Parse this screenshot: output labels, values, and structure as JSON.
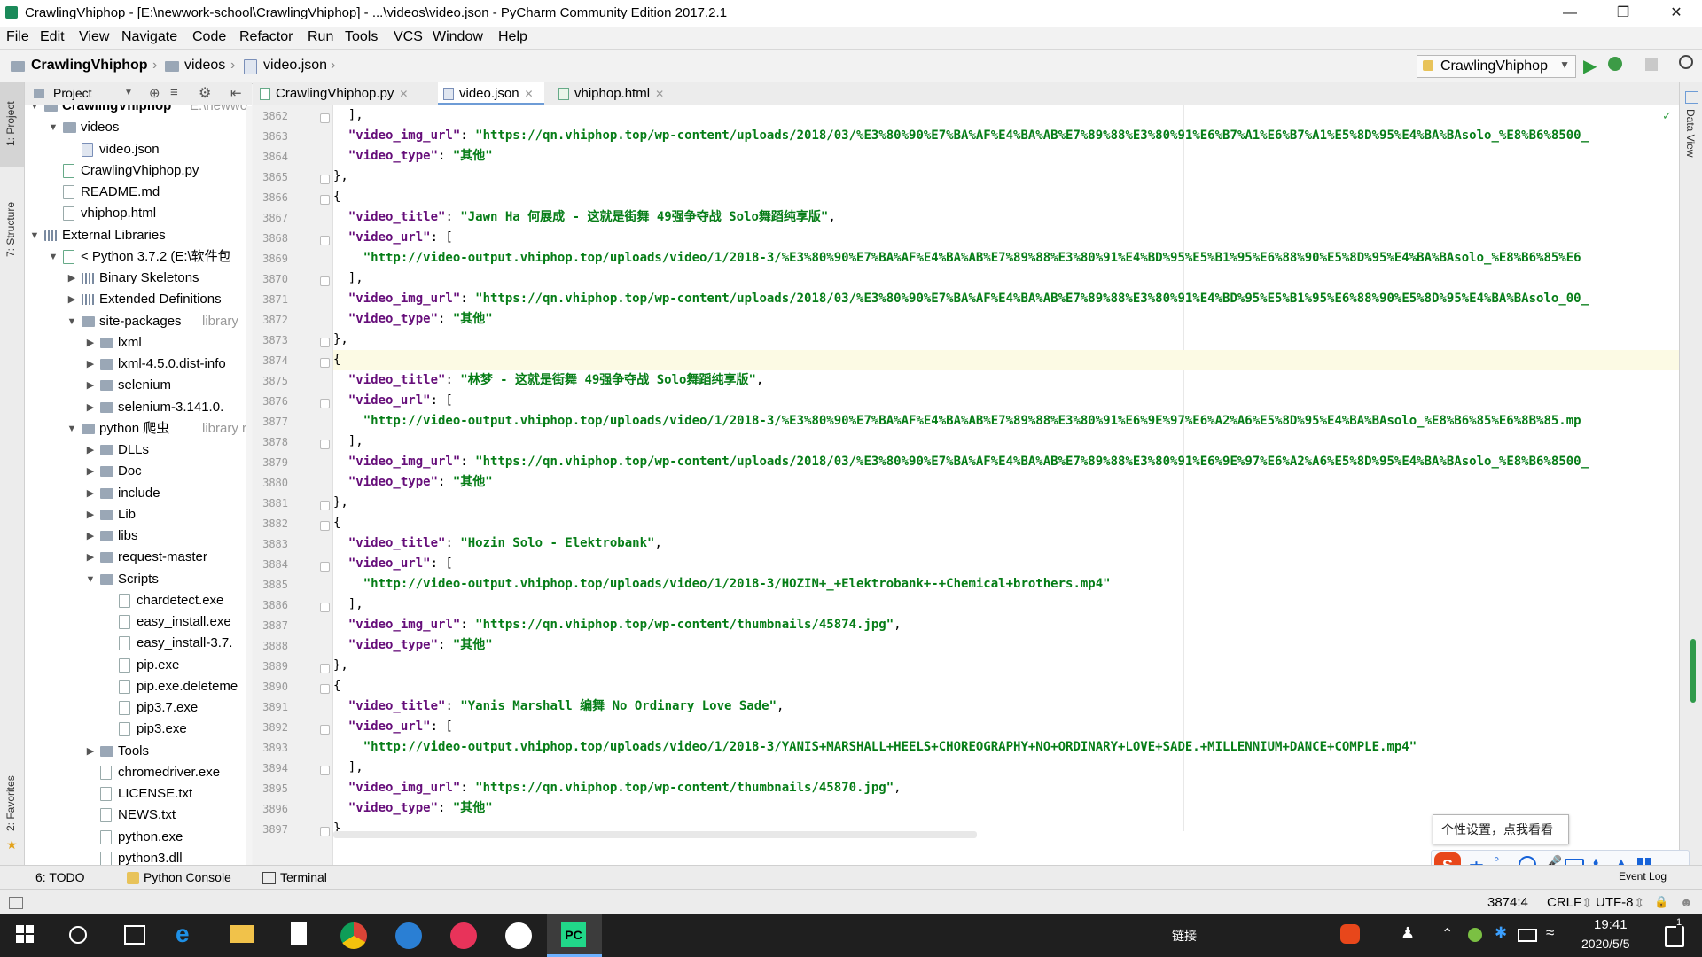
{
  "window": {
    "title": "CrawlingVhiphop - [E:\\newwork-school\\CrawlingVhiphop] - ...\\videos\\video.json - PyCharm Community Edition 2017.2.1"
  },
  "menu": [
    "File",
    "Edit",
    "View",
    "Navigate",
    "Code",
    "Refactor",
    "Run",
    "Tools",
    "VCS",
    "Window",
    "Help"
  ],
  "breadcrumb": [
    "CrawlingVhiphop",
    "videos",
    "video.json"
  ],
  "run_config": "CrawlingVhiphop",
  "left_tabs": [
    "1: Project",
    "7: Structure",
    "2: Favorites"
  ],
  "right_tabs": [
    "Data View"
  ],
  "project_panel": {
    "label": "Project"
  },
  "tree": [
    {
      "label": "CrawlingVhiphop",
      "hint": "E:\\newwo",
      "depth": 0,
      "arrow": "down",
      "icon": "folder",
      "bold": true
    },
    {
      "label": "videos",
      "depth": 1,
      "arrow": "down",
      "icon": "folder"
    },
    {
      "label": "video.json",
      "depth": 2,
      "icon": "json"
    },
    {
      "label": "CrawlingVhiphop.py",
      "depth": 1,
      "icon": "py"
    },
    {
      "label": "README.md",
      "depth": 1,
      "icon": "file"
    },
    {
      "label": "vhiphop.html",
      "depth": 1,
      "icon": "file"
    },
    {
      "label": "External Libraries",
      "depth": 0,
      "arrow": "down",
      "icon": "lib"
    },
    {
      "label": "< Python 3.7.2 (E:\\软件包",
      "depth": 1,
      "arrow": "down",
      "icon": "py"
    },
    {
      "label": "Binary Skeletons",
      "depth": 2,
      "arrow": "right",
      "icon": "lib"
    },
    {
      "label": "Extended Definitions",
      "depth": 2,
      "arrow": "right",
      "icon": "lib"
    },
    {
      "label": "site-packages",
      "hint": "library",
      "depth": 2,
      "arrow": "down",
      "icon": "folder"
    },
    {
      "label": "lxml",
      "depth": 3,
      "arrow": "right",
      "icon": "folder"
    },
    {
      "label": "lxml-4.5.0.dist-info",
      "depth": 3,
      "arrow": "right",
      "icon": "folder"
    },
    {
      "label": "selenium",
      "depth": 3,
      "arrow": "right",
      "icon": "folder"
    },
    {
      "label": "selenium-3.141.0.",
      "depth": 3,
      "arrow": "right",
      "icon": "folder"
    },
    {
      "label": "python 爬虫",
      "hint": "library ro",
      "depth": 2,
      "arrow": "down",
      "icon": "folder"
    },
    {
      "label": "DLLs",
      "depth": 3,
      "arrow": "right",
      "icon": "folder"
    },
    {
      "label": "Doc",
      "depth": 3,
      "arrow": "right",
      "icon": "folder"
    },
    {
      "label": "include",
      "depth": 3,
      "arrow": "right",
      "icon": "folder"
    },
    {
      "label": "Lib",
      "depth": 3,
      "arrow": "right",
      "icon": "folder"
    },
    {
      "label": "libs",
      "depth": 3,
      "arrow": "right",
      "icon": "folder"
    },
    {
      "label": "request-master",
      "depth": 3,
      "arrow": "right",
      "icon": "folder"
    },
    {
      "label": "Scripts",
      "depth": 3,
      "arrow": "down",
      "icon": "folder"
    },
    {
      "label": "chardetect.exe",
      "depth": 4,
      "icon": "file"
    },
    {
      "label": "easy_install.exe",
      "depth": 4,
      "icon": "file"
    },
    {
      "label": "easy_install-3.7.",
      "depth": 4,
      "icon": "file"
    },
    {
      "label": "pip.exe",
      "depth": 4,
      "icon": "file"
    },
    {
      "label": "pip.exe.deleteme",
      "depth": 4,
      "icon": "file"
    },
    {
      "label": "pip3.7.exe",
      "depth": 4,
      "icon": "file"
    },
    {
      "label": "pip3.exe",
      "depth": 4,
      "icon": "file"
    },
    {
      "label": "Tools",
      "depth": 3,
      "arrow": "right",
      "icon": "folder"
    },
    {
      "label": "chromedriver.exe",
      "depth": 3,
      "icon": "file"
    },
    {
      "label": "LICENSE.txt",
      "depth": 3,
      "icon": "file"
    },
    {
      "label": "NEWS.txt",
      "depth": 3,
      "icon": "file"
    },
    {
      "label": "python.exe",
      "depth": 3,
      "icon": "file"
    },
    {
      "label": "python3.dll",
      "depth": 3,
      "icon": "file"
    }
  ],
  "tabs": [
    {
      "label": "CrawlingVhiphop.py",
      "active": false
    },
    {
      "label": "video.json",
      "active": true
    },
    {
      "label": "vhiphop.html",
      "active": false
    }
  ],
  "editor": {
    "current_line": 3874,
    "lines": [
      {
        "n": 3862,
        "tokens": [
          [
            "p",
            "  ],"
          ]
        ]
      },
      {
        "n": 3863,
        "tokens": [
          [
            "k",
            "  \"video_img_url\""
          ],
          [
            "p",
            ": "
          ],
          [
            "s",
            "\"https://qn.vhiphop.top/wp-content/uploads/2018/03/%E3%80%90%E7%BA%AF%E4%BA%AB%E7%89%88%E3%80%91%E6%B7%A1%E6%B7%A1%E5%8D%95%E4%BA%BAsolo_%E8%B6%8500_"
          ]
        ]
      },
      {
        "n": 3864,
        "tokens": [
          [
            "k",
            "  \"video_type\""
          ],
          [
            "p",
            ": "
          ],
          [
            "s",
            "\"其他\""
          ]
        ]
      },
      {
        "n": 3865,
        "tokens": [
          [
            "p",
            "},"
          ]
        ]
      },
      {
        "n": 3866,
        "tokens": [
          [
            "p",
            "{"
          ]
        ]
      },
      {
        "n": 3867,
        "tokens": [
          [
            "k",
            "  \"video_title\""
          ],
          [
            "p",
            ": "
          ],
          [
            "s",
            "\"Jawn Ha 何展成 - 这就是街舞 49强争夺战 Solo舞蹈纯享版\""
          ],
          [
            "p",
            ","
          ]
        ]
      },
      {
        "n": 3868,
        "tokens": [
          [
            "k",
            "  \"video_url\""
          ],
          [
            "p",
            ": ["
          ]
        ]
      },
      {
        "n": 3869,
        "tokens": [
          [
            "s",
            "    \"http://video-output.vhiphop.top/uploads/video/1/2018-3/%E3%80%90%E7%BA%AF%E4%BA%AB%E7%89%88%E3%80%91%E4%BD%95%E5%B1%95%E6%88%90%E5%8D%95%E4%BA%BAsolo_%E8%B6%85%E6"
          ]
        ]
      },
      {
        "n": 3870,
        "tokens": [
          [
            "p",
            "  ],"
          ]
        ]
      },
      {
        "n": 3871,
        "tokens": [
          [
            "k",
            "  \"video_img_url\""
          ],
          [
            "p",
            ": "
          ],
          [
            "s",
            "\"https://qn.vhiphop.top/wp-content/uploads/2018/03/%E3%80%90%E7%BA%AF%E4%BA%AB%E7%89%88%E3%80%91%E4%BD%95%E5%B1%95%E6%88%90%E5%8D%95%E4%BA%BAsolo_00_"
          ]
        ]
      },
      {
        "n": 3872,
        "tokens": [
          [
            "k",
            "  \"video_type\""
          ],
          [
            "p",
            ": "
          ],
          [
            "s",
            "\"其他\""
          ]
        ]
      },
      {
        "n": 3873,
        "tokens": [
          [
            "p",
            "},"
          ]
        ]
      },
      {
        "n": 3874,
        "tokens": [
          [
            "p",
            "{"
          ]
        ]
      },
      {
        "n": 3875,
        "tokens": [
          [
            "k",
            "  \"video_title\""
          ],
          [
            "p",
            ": "
          ],
          [
            "s",
            "\"林梦 - 这就是街舞 49强争夺战 Solo舞蹈纯享版\""
          ],
          [
            "p",
            ","
          ]
        ]
      },
      {
        "n": 3876,
        "tokens": [
          [
            "k",
            "  \"video_url\""
          ],
          [
            "p",
            ": ["
          ]
        ]
      },
      {
        "n": 3877,
        "tokens": [
          [
            "s",
            "    \"http://video-output.vhiphop.top/uploads/video/1/2018-3/%E3%80%90%E7%BA%AF%E4%BA%AB%E7%89%88%E3%80%91%E6%9E%97%E6%A2%A6%E5%8D%95%E4%BA%BAsolo_%E8%B6%85%E6%8B%85.mp"
          ]
        ]
      },
      {
        "n": 3878,
        "tokens": [
          [
            "p",
            "  ],"
          ]
        ]
      },
      {
        "n": 3879,
        "tokens": [
          [
            "k",
            "  \"video_img_url\""
          ],
          [
            "p",
            ": "
          ],
          [
            "s",
            "\"https://qn.vhiphop.top/wp-content/uploads/2018/03/%E3%80%90%E7%BA%AF%E4%BA%AB%E7%89%88%E3%80%91%E6%9E%97%E6%A2%A6%E5%8D%95%E4%BA%BAsolo_%E8%B6%8500_"
          ]
        ]
      },
      {
        "n": 3880,
        "tokens": [
          [
            "k",
            "  \"video_type\""
          ],
          [
            "p",
            ": "
          ],
          [
            "s",
            "\"其他\""
          ]
        ]
      },
      {
        "n": 3881,
        "tokens": [
          [
            "p",
            "},"
          ]
        ]
      },
      {
        "n": 3882,
        "tokens": [
          [
            "p",
            "{"
          ]
        ]
      },
      {
        "n": 3883,
        "tokens": [
          [
            "k",
            "  \"video_title\""
          ],
          [
            "p",
            ": "
          ],
          [
            "s",
            "\"Hozin Solo - Elektrobank\""
          ],
          [
            "p",
            ","
          ]
        ]
      },
      {
        "n": 3884,
        "tokens": [
          [
            "k",
            "  \"video_url\""
          ],
          [
            "p",
            ": ["
          ]
        ]
      },
      {
        "n": 3885,
        "tokens": [
          [
            "s",
            "    \"http://video-output.vhiphop.top/uploads/video/1/2018-3/HOZIN+_+Elektrobank+-+Chemical+brothers.mp4\""
          ]
        ]
      },
      {
        "n": 3886,
        "tokens": [
          [
            "p",
            "  ],"
          ]
        ]
      },
      {
        "n": 3887,
        "tokens": [
          [
            "k",
            "  \"video_img_url\""
          ],
          [
            "p",
            ": "
          ],
          [
            "s",
            "\"https://qn.vhiphop.top/wp-content/thumbnails/45874.jpg\""
          ],
          [
            "p",
            ","
          ]
        ]
      },
      {
        "n": 3888,
        "tokens": [
          [
            "k",
            "  \"video_type\""
          ],
          [
            "p",
            ": "
          ],
          [
            "s",
            "\"其他\""
          ]
        ]
      },
      {
        "n": 3889,
        "tokens": [
          [
            "p",
            "},"
          ]
        ]
      },
      {
        "n": 3890,
        "tokens": [
          [
            "p",
            "{"
          ]
        ]
      },
      {
        "n": 3891,
        "tokens": [
          [
            "k",
            "  \"video_title\""
          ],
          [
            "p",
            ": "
          ],
          [
            "s",
            "\"Yanis Marshall 编舞 No Ordinary Love Sade\""
          ],
          [
            "p",
            ","
          ]
        ]
      },
      {
        "n": 3892,
        "tokens": [
          [
            "k",
            "  \"video_url\""
          ],
          [
            "p",
            ": ["
          ]
        ]
      },
      {
        "n": 3893,
        "tokens": [
          [
            "s",
            "    \"http://video-output.vhiphop.top/uploads/video/1/2018-3/YANIS+MARSHALL+HEELS+CHOREOGRAPHY+NO+ORDINARY+LOVE+SADE.+MILLENNIUM+DANCE+COMPLE.mp4\""
          ]
        ]
      },
      {
        "n": 3894,
        "tokens": [
          [
            "p",
            "  ],"
          ]
        ]
      },
      {
        "n": 3895,
        "tokens": [
          [
            "k",
            "  \"video_img_url\""
          ],
          [
            "p",
            ": "
          ],
          [
            "s",
            "\"https://qn.vhiphop.top/wp-content/thumbnails/45870.jpg\""
          ],
          [
            "p",
            ","
          ]
        ]
      },
      {
        "n": 3896,
        "tokens": [
          [
            "k",
            "  \"video_type\""
          ],
          [
            "p",
            ": "
          ],
          [
            "s",
            "\"其他\""
          ]
        ]
      },
      {
        "n": 3897,
        "tokens": [
          [
            "p",
            "}"
          ]
        ]
      }
    ]
  },
  "bottom_tools": [
    "6: TODO",
    "Python Console",
    "Terminal"
  ],
  "event_log": "Event Log",
  "status": {
    "position": "3874:4",
    "line_sep": "CRLF",
    "encoding": "UTF-8"
  },
  "ime": {
    "tooltip": "个性设置，点我看看",
    "mode": "中"
  },
  "taskbar": {
    "tray_text": "链接",
    "time": "19:41",
    "date": "2020/5/5",
    "notification_count": "1"
  },
  "colors": {
    "key": "#660e7a",
    "string": "#067d17",
    "accent": "#6e9cd6",
    "current_line": "#fcfae4"
  }
}
